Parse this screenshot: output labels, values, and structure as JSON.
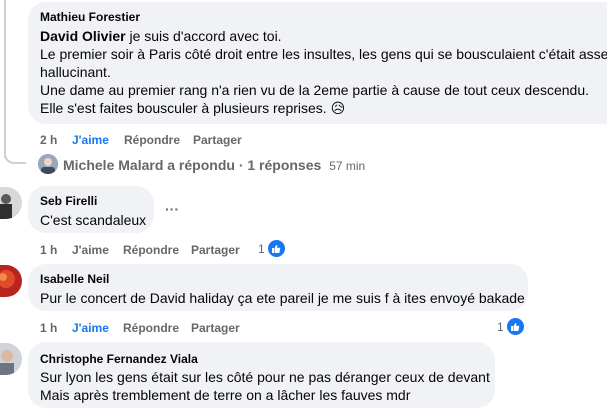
{
  "comments": [
    {
      "author": "Mathieu Forestier",
      "mention": "David Olivier",
      "lines": [
        " je suis d'accord avec toi.",
        "Le premier soir à Paris côté droit entre les insultes, les gens qui se bousculaient c'était assez",
        "hallucinant.",
        "Une dame au premier rang n'a rien vu de la 2eme partie à cause de tout ceux descendu.",
        "Elle s'est faites bousculer à plusieurs reprises. 😥"
      ],
      "time": "2 h",
      "like": "J'aime",
      "reply": "Répondre",
      "share": "Partager"
    },
    {
      "author": "Seb Firelli",
      "lines": [
        "C'est scandaleux"
      ],
      "more": "···",
      "time": "1 h",
      "like": "J'aime",
      "reply": "Répondre",
      "share": "Partager",
      "reactions": "1"
    },
    {
      "author": "Isabelle Neil",
      "lines": [
        "Pur le concert de David haliday ça ete pareil je me suis f à ites envoyé bakade"
      ],
      "time": "1 h",
      "like": "J'aime",
      "reply": "Répondre",
      "share": "Partager",
      "reactions": "1"
    },
    {
      "author": "Christophe Fernandez Viala",
      "lines": [
        "Sur lyon les gens était sur les côté pour ne pas déranger ceux de devant",
        "Mais après tremblement de terre on a lâcher les fauves mdr"
      ]
    }
  ],
  "reply_summary": {
    "text": "Michele Malard a répondu · 1 réponses",
    "time": "57 min"
  },
  "colors": {
    "bubble": "#f0f2f5",
    "accent": "#1877f2",
    "muted": "#65676b"
  }
}
